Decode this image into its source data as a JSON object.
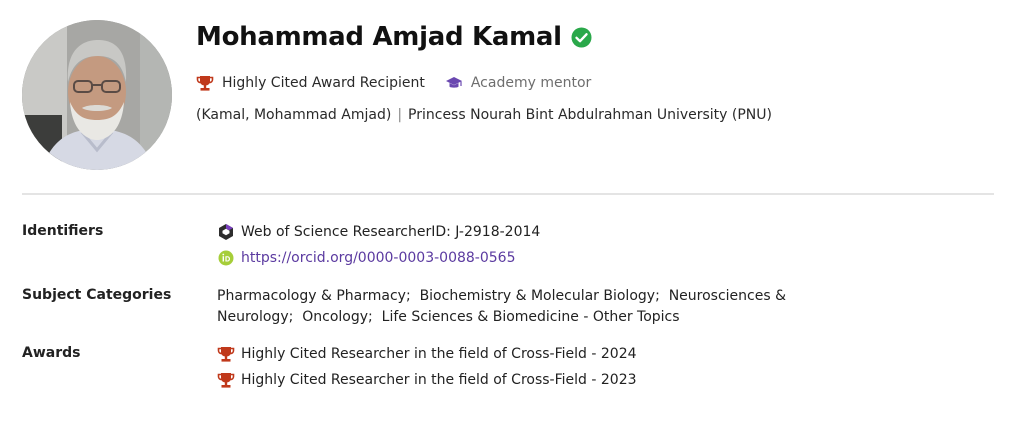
{
  "profile": {
    "name": "Mohammad Amjad Kamal",
    "verified": true,
    "badges": [
      {
        "label": "Highly Cited Award Recipient",
        "icon": "trophy-icon",
        "color": "#c0391b"
      },
      {
        "label": "Academy mentor",
        "icon": "graduation-cap-icon",
        "color": "#6a48b0"
      }
    ],
    "alias": "(Kamal, Mohammad Amjad)",
    "separator": "|",
    "institution": "Princess Nourah Bint Abdulrahman University (PNU)"
  },
  "identifiers": {
    "label": "Identifiers",
    "researcher_id": "Web of Science ResearcherID: J-2918-2014",
    "orcid_url": "https://orcid.org/0000-0003-0088-0565"
  },
  "subjects": {
    "label": "Subject Categories",
    "items": [
      "Pharmacology & Pharmacy",
      "Biochemistry & Molecular Biology",
      "Neurosciences & Neurology",
      "Oncology",
      "Life Sciences & Biomedicine - Other Topics"
    ]
  },
  "awards": {
    "label": "Awards",
    "items": [
      "Highly Cited Researcher in the field of Cross-Field - 2024",
      "Highly Cited Researcher in the field of Cross-Field - 2023"
    ]
  },
  "colors": {
    "verified": "#2aa84a",
    "trophy": "#c0391b",
    "mentor": "#6a48b0",
    "orcid": "#a6ce39",
    "link": "#5b3aa0"
  }
}
